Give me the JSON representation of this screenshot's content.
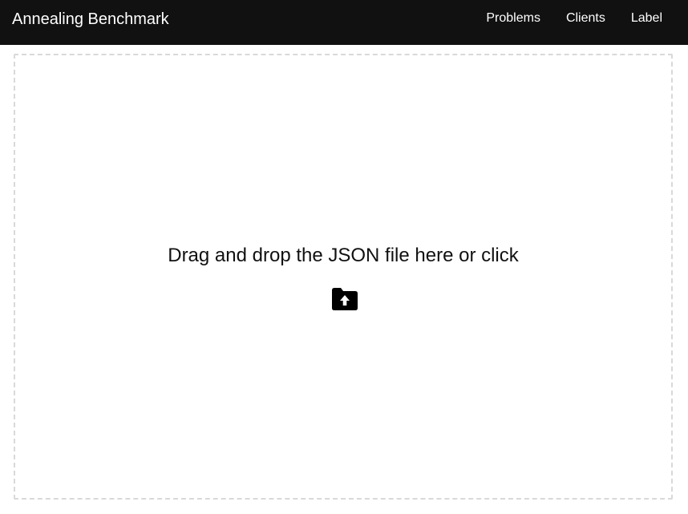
{
  "navbar": {
    "brand": "Annealing Benchmark",
    "links": [
      {
        "label": "Problems"
      },
      {
        "label": "Clients"
      },
      {
        "label": "Label"
      }
    ]
  },
  "dropzone": {
    "prompt": "Drag and drop the JSON file here or click",
    "icon": "folder-upload-icon"
  },
  "colors": {
    "navbar_background": "#111111",
    "navbar_text": "#ffffff",
    "dropzone_border": "#d9d9d9"
  }
}
